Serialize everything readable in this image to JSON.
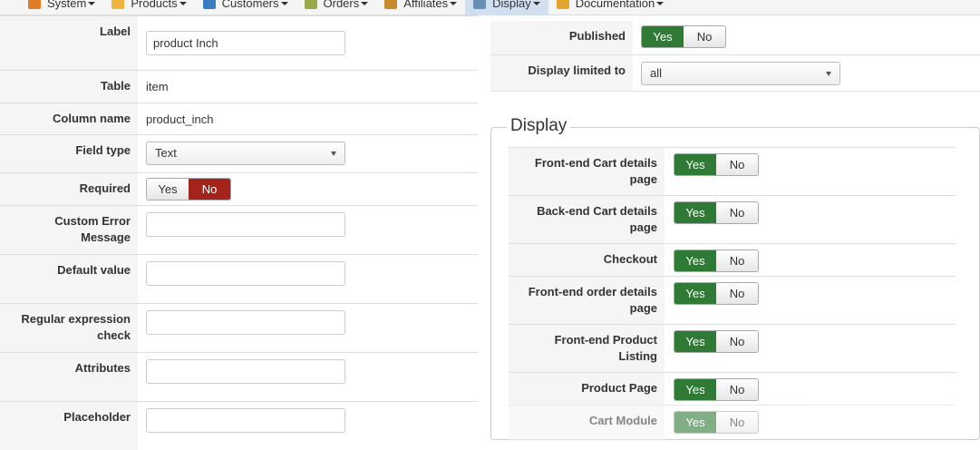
{
  "nav": {
    "items": [
      {
        "label": "System",
        "icon": "system-icon",
        "color": "#e07b26"
      },
      {
        "label": "Products",
        "icon": "products-icon",
        "color": "#f2b33d"
      },
      {
        "label": "Customers",
        "icon": "customers-icon",
        "color": "#3b7bbf"
      },
      {
        "label": "Orders",
        "icon": "orders-icon",
        "color": "#9aa84a"
      },
      {
        "label": "Affiliates",
        "icon": "affiliates-icon",
        "color": "#c98a2e"
      },
      {
        "label": "Display",
        "icon": "display-icon",
        "color": "#6a8fb5"
      },
      {
        "label": "Documentation",
        "icon": "documentation-icon",
        "color": "#e5a52a"
      }
    ],
    "active": "Display"
  },
  "left": {
    "label": {
      "label": "Label",
      "value": "product Inch"
    },
    "table": {
      "label": "Table",
      "value": "item"
    },
    "column": {
      "label": "Column name",
      "value": "product_inch"
    },
    "fieldtype": {
      "label": "Field type",
      "value": "Text"
    },
    "required": {
      "label": "Required",
      "yes": "Yes",
      "no": "No",
      "selected": "No"
    },
    "custom_error": {
      "label": "Custom Error Message",
      "value": ""
    },
    "default_value": {
      "label": "Default value",
      "value": ""
    },
    "regex": {
      "label": "Regular expression check",
      "value": ""
    },
    "attributes": {
      "label": "Attributes",
      "value": ""
    },
    "placeholder": {
      "label": "Placeholder",
      "value": ""
    }
  },
  "right": {
    "published": {
      "label": "Published",
      "yes": "Yes",
      "no": "No",
      "selected": "Yes"
    },
    "display_limited": {
      "label": "Display limited to",
      "value": "all"
    }
  },
  "display": {
    "legend": "Display",
    "rows": [
      {
        "label": "Front-end Cart details page",
        "yes": "Yes",
        "no": "No",
        "selected": "Yes"
      },
      {
        "label": "Back-end Cart details page",
        "yes": "Yes",
        "no": "No",
        "selected": "Yes"
      },
      {
        "label": "Checkout",
        "yes": "Yes",
        "no": "No",
        "selected": "Yes"
      },
      {
        "label": "Front-end order details page",
        "yes": "Yes",
        "no": "No",
        "selected": "Yes"
      },
      {
        "label": "Front-end Product Listing",
        "yes": "Yes",
        "no": "No",
        "selected": "Yes"
      },
      {
        "label": "Product Page",
        "yes": "Yes",
        "no": "No",
        "selected": "Yes"
      },
      {
        "label": "Cart Module",
        "yes": "Yes",
        "no": "No",
        "selected": "Yes"
      }
    ]
  },
  "colors": {
    "yes_active": "#2f7a34",
    "no_active": "#a4241c"
  }
}
